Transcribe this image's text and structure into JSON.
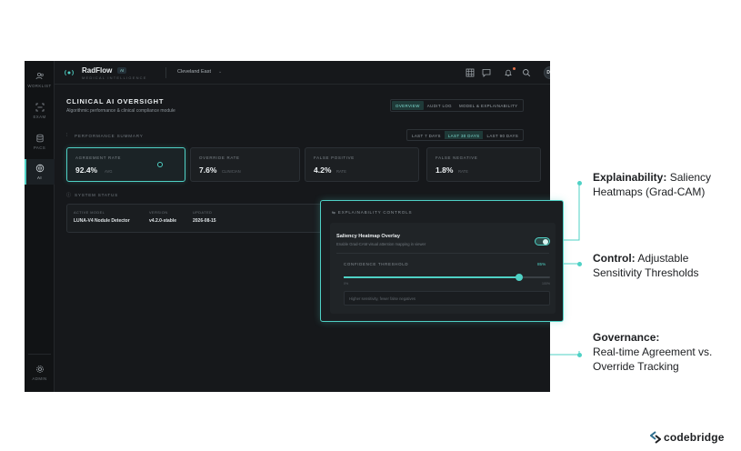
{
  "app": {
    "brand": "RadFlow",
    "brand_badge": "AI",
    "brand_subtitle": "MEDICAL INTELLIGENCE",
    "site": "Cleveland East",
    "avatar_initials": "DR"
  },
  "sidebar": {
    "items": [
      {
        "label": "WORKLIST",
        "icon": "users-icon"
      },
      {
        "label": "EXAM",
        "icon": "scan-icon"
      },
      {
        "label": "PACS",
        "icon": "database-icon"
      },
      {
        "label": "AI",
        "icon": "brain-icon"
      }
    ],
    "admin_label": "ADMIN"
  },
  "header": {
    "title": "CLINICAL AI OVERSIGHT",
    "subtitle": "Algorithmic performance & clinical compliance module",
    "tabs": [
      "OVERVIEW",
      "AUDIT LOG",
      "MODEL & EXPLAINABILITY"
    ],
    "active_tab": "OVERVIEW"
  },
  "performance": {
    "section_label": "PERFORMANCE SUMMARY",
    "ranges": [
      "LAST 7 DAYS",
      "LAST 30 DAYS",
      "LAST 90 DAYS"
    ],
    "active_range": "LAST 30 DAYS",
    "metrics": [
      {
        "label": "AGREEMENT RATE",
        "value": "92.4%",
        "suffix": "AVG"
      },
      {
        "label": "OVERRIDE RATE",
        "value": "7.6%",
        "suffix": "CLINICIAN"
      },
      {
        "label": "FALSE POSITIVE",
        "value": "4.2%",
        "suffix": "RATE"
      },
      {
        "label": "FALSE NEGATIVE",
        "value": "1.8%",
        "suffix": "RATE"
      }
    ]
  },
  "system_status": {
    "section_label": "SYSTEM STATUS",
    "active_model_label": "ACTIVE MODEL",
    "active_model": "LUNA-V4 Nodule Detector",
    "version_label": "VERSION",
    "version": "v4.2.0-stable",
    "updated_label": "UPDATED",
    "updated": "2026-08-15"
  },
  "explainability": {
    "section_label": "EXPLAINABILITY CONTROLS",
    "overlay_title": "Saliency Heatmap Overlay",
    "overlay_desc": "Enable Grad-CAM visual attention mapping in viewer",
    "overlay_enabled": true,
    "threshold_label": "CONFIDENCE THRESHOLD",
    "threshold_value": "85%",
    "threshold_fraction": 0.85,
    "slider_min": "0%",
    "slider_max": "100%",
    "hint": "Higher sensitivity, fewer false negatives"
  },
  "callouts": [
    {
      "bold": "Explainability:",
      "rest1": " Saliency",
      "rest2": "Heatmaps (Grad-CAM)"
    },
    {
      "bold": "Control:",
      "rest1": " Adjustable",
      "rest2": "Sensitivity Thresholds"
    },
    {
      "bold": "Governance:",
      "rest1": "",
      "rest2": "Real-time Agreement vs.",
      "rest3": "Override Tracking"
    }
  ],
  "footer": {
    "brand": "codebridge"
  },
  "colors": {
    "accent": "#4fd1c5",
    "app_bg": "#16181b",
    "page_bg": "#ffffff"
  }
}
